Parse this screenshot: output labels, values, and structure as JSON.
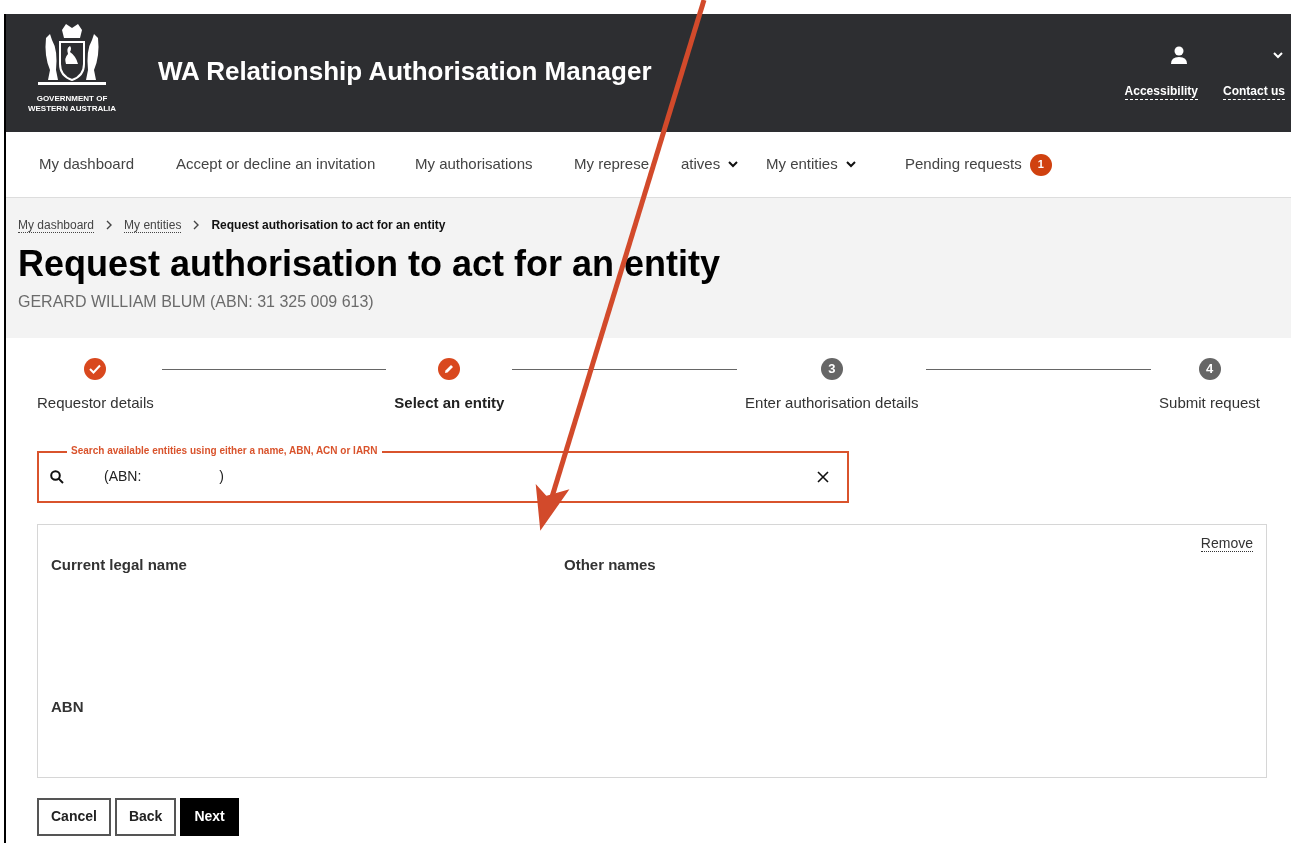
{
  "header": {
    "logo_caption": [
      "GOVERNMENT OF",
      "WESTERN AUSTRALIA"
    ],
    "title": "WA Relationship Authorisation Manager",
    "links": [
      "Accessibility",
      "Contact us"
    ]
  },
  "nav": [
    {
      "label": "My dashboard",
      "dropdown": false
    },
    {
      "label": "Accept or decline an invitation",
      "dropdown": false
    },
    {
      "label": "My authorisations",
      "dropdown": false
    },
    {
      "label_parts": [
        "My represe",
        "atives"
      ],
      "dropdown": true
    },
    {
      "label": "My entities",
      "dropdown": true
    },
    {
      "label": "Pending requests",
      "dropdown": false,
      "badge": "1"
    }
  ],
  "breadcrumb": [
    {
      "label": "My dashboard",
      "link": true
    },
    {
      "label": "My entities",
      "link": true
    },
    {
      "label": "Request authorisation to act for an entity",
      "link": false
    }
  ],
  "page_title": "Request authorisation to act for an entity",
  "subtitle": "GERARD WILLIAM BLUM (ABN: 31 325 009 613)",
  "steps": [
    {
      "label": "Requestor details",
      "kind": "done"
    },
    {
      "label": "Select an entity",
      "kind": "current"
    },
    {
      "label": "Enter authorisation details",
      "kind": "todo",
      "number": "3"
    },
    {
      "label": "Submit request",
      "kind": "todo",
      "number": "4"
    }
  ],
  "search": {
    "label": "Search available entities using either a name, ABN, ACN or IARN",
    "value": "(ABN:                    )"
  },
  "entity_card": {
    "remove": "Remove",
    "fields": [
      "Current legal name",
      "Other names",
      "ABN"
    ]
  },
  "buttons": [
    {
      "label": "Cancel",
      "primary": false
    },
    {
      "label": "Back",
      "primary": false
    },
    {
      "label": "Next",
      "primary": true
    }
  ]
}
